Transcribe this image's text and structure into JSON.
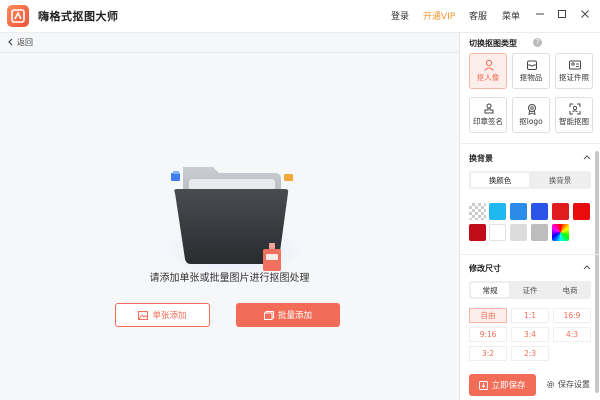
{
  "app": {
    "title": "嗨格式抠图大师"
  },
  "topmenu": {
    "login": "登录",
    "vip": "开通VIP",
    "service": "客服",
    "menu": "菜单"
  },
  "nav": {
    "back": "返回"
  },
  "main": {
    "empty_hint": "请添加单张或批量图片进行抠图处理",
    "add_single": "单张添加",
    "add_batch": "批量添加"
  },
  "panel": {
    "type_section": "切换抠图类型",
    "types": [
      {
        "label": "抠人像",
        "icon": "person-icon",
        "active": true
      },
      {
        "label": "抠物品",
        "icon": "box-icon",
        "active": false
      },
      {
        "label": "抠证件照",
        "icon": "id-card-icon",
        "active": false
      },
      {
        "label": "印章签名",
        "icon": "stamp-icon",
        "active": false
      },
      {
        "label": "抠logo",
        "icon": "badge-icon",
        "active": false
      },
      {
        "label": "智能抠图",
        "icon": "scan-icon",
        "active": false
      }
    ],
    "bg_section": "换背景",
    "bg_tabs": [
      "换颜色",
      "换背景"
    ],
    "colors": [
      "transparent",
      "#1fb8f0",
      "#2b8be8",
      "#2b55e6",
      "#e01c1c",
      "#e80c0c",
      "#c10d1a",
      "#ffffff",
      "#dcdcdc",
      "#bdbdbd",
      "rainbow"
    ],
    "size_section": "修改尺寸",
    "size_tabs": [
      "常规",
      "证件",
      "电商"
    ],
    "sizes": [
      "自由",
      "1:1",
      "16:9",
      "9:16",
      "3:4",
      "4:3",
      "3:2",
      "2:3"
    ],
    "save": "立即保存",
    "save_settings": "保存设置"
  }
}
